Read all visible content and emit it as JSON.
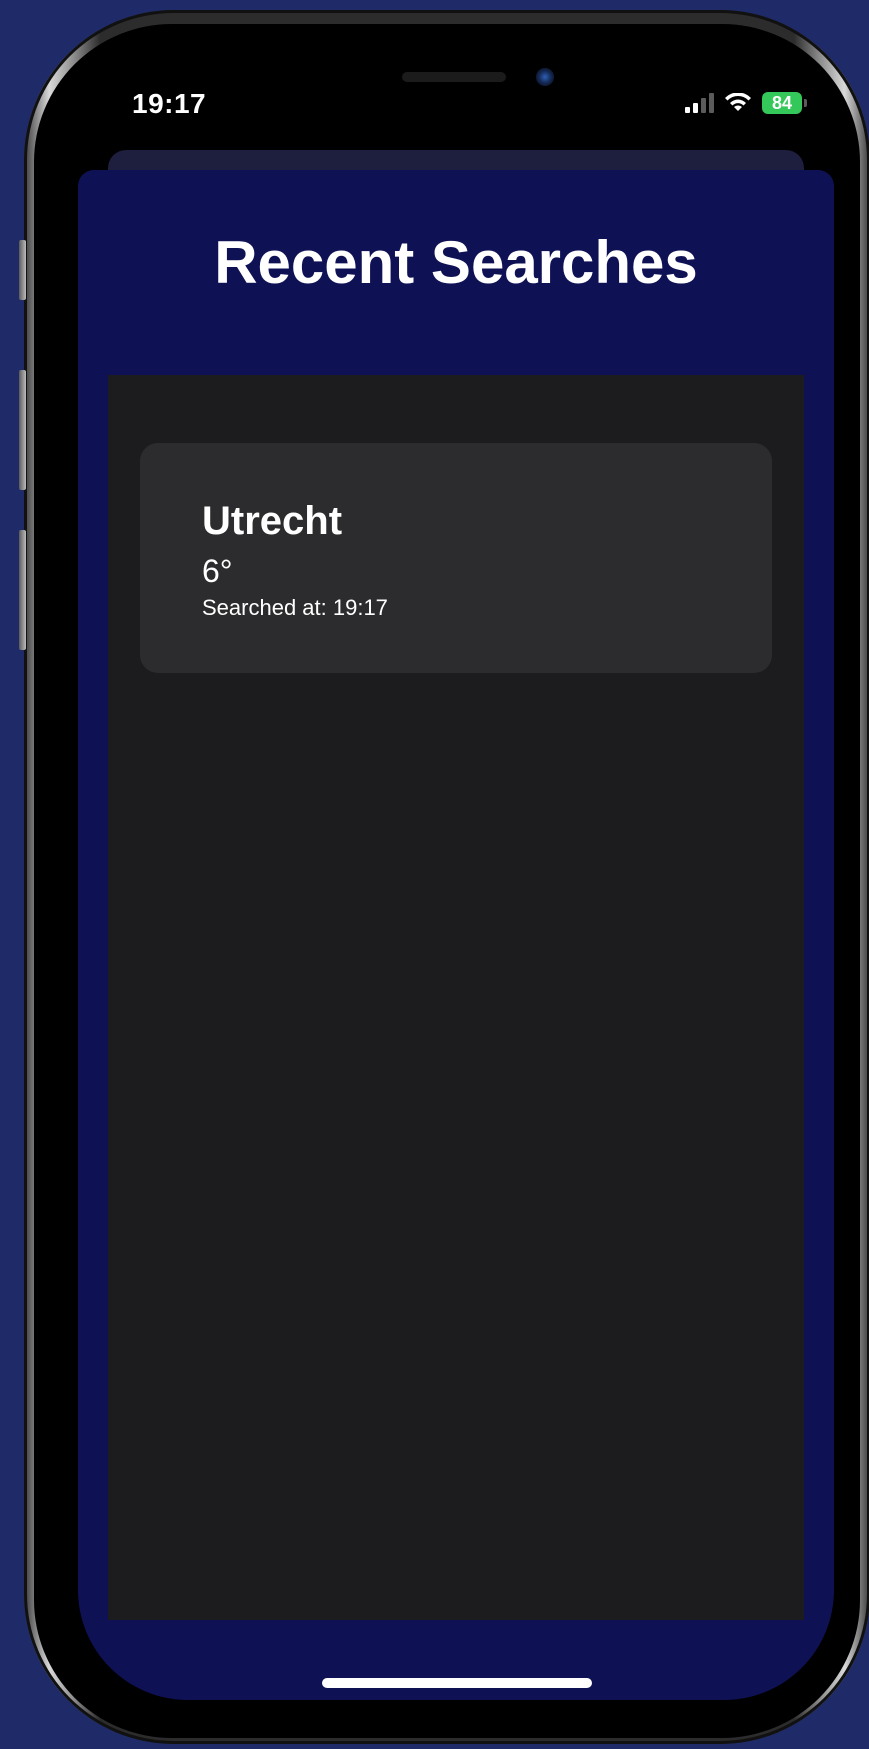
{
  "status_bar": {
    "time": "19:17",
    "battery": "84",
    "icons": [
      "cellular-signal-icon",
      "wifi-icon",
      "battery-charging-icon"
    ]
  },
  "header": {
    "title": "Recent Searches"
  },
  "searches": [
    {
      "city": "Utrecht",
      "temperature": "6°",
      "searched_at": "Searched at: 19:17"
    }
  ],
  "colors": {
    "backdrop": "#1f2b69",
    "sheet": "#0f1155",
    "list_background": "#1c1c1e",
    "card_background": "#2c2c2e",
    "battery": "#34c759",
    "text": "#ffffff"
  }
}
